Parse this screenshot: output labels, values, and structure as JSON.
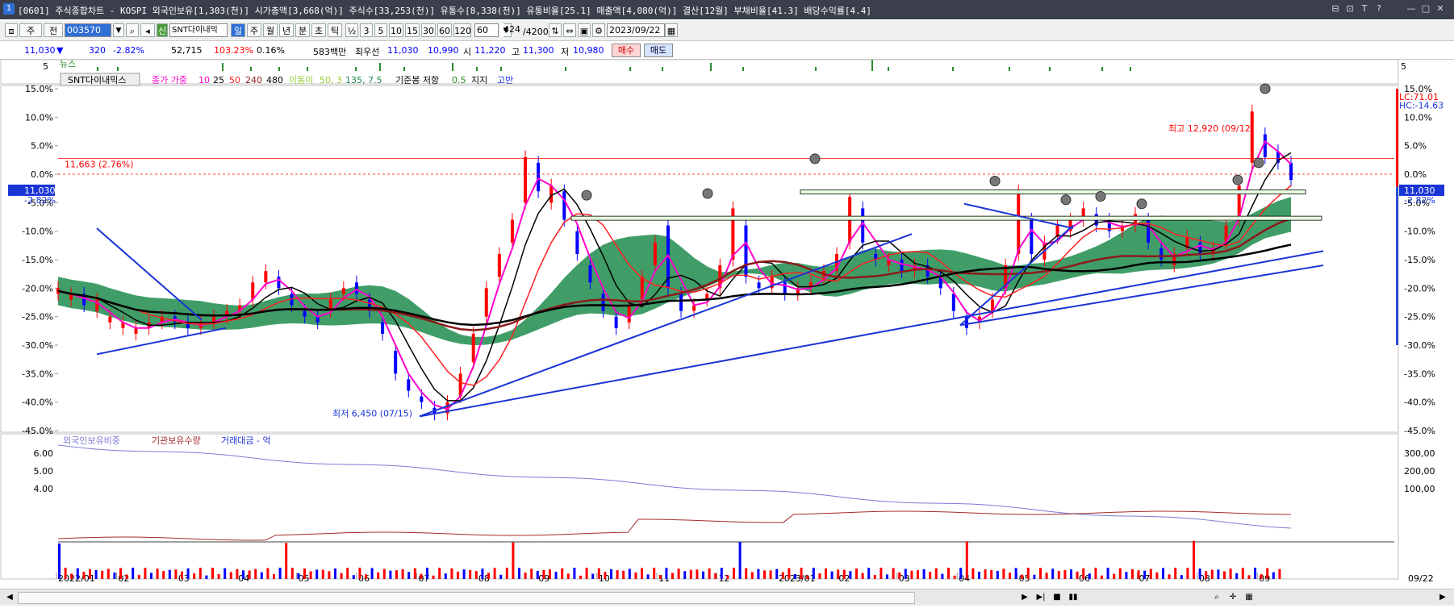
{
  "window": {
    "badge": "1",
    "title": "[0601] 주식종합차트 - KOSPI 외국인보유[1,303(천)] 시가총액[3,668(억)] 주식수[33,253(천)] 유통수[8,338(천)] 유통비율[25.1] 매출액[4,080(억)] 결산[12월] 부채비율[41.3] 배당수익률[4.4]",
    "controls": [
      "⊟",
      "⊡",
      "T",
      "?",
      "—",
      "□",
      "✕"
    ]
  },
  "toolbar": {
    "mode": "주",
    "scope": "전",
    "code": "003570",
    "search_icon": "search-icon",
    "stock_badge": "신",
    "stock_name": "SNT다이내믹",
    "periods": [
      "일",
      "주",
      "월",
      "년",
      "분",
      "초",
      "틱"
    ],
    "active_period": "일",
    "intervals": [
      "½",
      "3",
      "5",
      "10",
      "15",
      "30",
      "60",
      "120"
    ],
    "interval_value": "60",
    "count": "424",
    "count_total": "/4200",
    "date": "2023/09/22"
  },
  "quote": {
    "price": "11,030",
    "arrow": "▼",
    "change": "320",
    "change_pct": "-2.82%",
    "volume": "52,715",
    "vol_ratio": "103.23%",
    "turnover": "0.16%",
    "amount": "583백만",
    "bid_label": "최우선",
    "ask": "11,030",
    "bid": "10,990",
    "open_label": "시",
    "open": "11,220",
    "high_label": "고",
    "high": "11,300",
    "low_label": "저",
    "low": "10,980",
    "buy_label": "매수",
    "sell_label": "매도"
  },
  "colors": {
    "up": "#ff0000",
    "down": "#0000ff",
    "ma5": "#ff00cc",
    "ma10": "#000000",
    "ma25": "#ff2020",
    "ma50": "#8b1a1a",
    "ma240": "#000000",
    "cloud_lead": "#1e8c4e",
    "cloud_lag": "#9acd32",
    "trendline": "#1a35d6",
    "foreign": "#7b7bd6",
    "inst": "#a52a2a"
  },
  "chart_data": [
    {
      "type": "bar",
      "panel": "news",
      "legend": "뉴스",
      "ytick": "5",
      "x": [
        120,
        145,
        275,
        310,
        345,
        380,
        440,
        470,
        500,
        560,
        590,
        620,
        700,
        780,
        820,
        880,
        920,
        1010,
        1080,
        1100,
        1180,
        1250,
        1300,
        1365,
        1400
      ],
      "values": [
        1,
        1,
        2,
        1,
        1,
        1,
        1,
        2,
        1,
        2,
        1,
        1,
        1,
        1,
        1,
        2,
        1,
        1,
        3,
        1,
        1,
        1,
        1,
        1,
        1
      ]
    },
    {
      "type": "line",
      "panel": "price",
      "legend": {
        "name": "SNT다이내믹스",
        "ma_label": "종가 가중",
        "ma_periods": [
          "10",
          "25",
          "50",
          "240",
          "480"
        ],
        "cloud_label": "이동이",
        "cloud_params": "50, 3",
        "cloud_params2": "135, 7.5",
        "base_label": "기준봉 저항",
        "base_value": "0.5",
        "support_label": "지지",
        "high_label": "고반"
      },
      "yticks": [
        "15.0%",
        "10.0%",
        "5.0%",
        "0.0%",
        "-5.0%",
        "-10.0%",
        "-15.0%",
        "-20.0%",
        "-25.0%",
        "-30.0%",
        "-35.0%",
        "-40.0%",
        "-45.0%"
      ],
      "ytick_values": [
        15,
        10,
        5,
        0,
        -5,
        -10,
        -15,
        -20,
        -25,
        -30,
        -35,
        -40,
        -45
      ],
      "ylim": [
        -45,
        15
      ],
      "x_months": [
        "2022/01",
        "02",
        "03",
        "04",
        "05",
        "06",
        "07",
        "08",
        "09",
        "10",
        "11",
        "12",
        "2023/01",
        "02",
        "03",
        "04",
        "05",
        "06",
        "07",
        "08",
        "09",
        "09/22"
      ],
      "ref_line": {
        "label": "11,663 (2.76%)",
        "value": 2.76
      },
      "last_value": {
        "left_label": "11,030",
        "left_pct": "-2.82%",
        "right_label": "11,030",
        "right_pct": "-2.82%",
        "value": -2.82
      },
      "lc_label": "LC:71.01",
      "hc_label": "HC:-14.63",
      "high_annot": "최고 12,920 (09/12)",
      "low_annot": "최저 6,450 (07/15)",
      "resistance_bands": [
        -3.2,
        -7.8
      ],
      "price_series": [
        [
          -21,
          -20
        ],
        [
          -22,
          -21
        ],
        [
          -21,
          -23
        ],
        [
          -24,
          -22
        ],
        [
          -26,
          -25
        ],
        [
          -27,
          -26
        ],
        [
          -28,
          -27
        ],
        [
          -27,
          -26
        ],
        [
          -26,
          -25
        ],
        [
          -25,
          -26
        ],
        [
          -26,
          -27
        ],
        [
          -27,
          -26
        ],
        [
          -26,
          -25
        ],
        [
          -25,
          -24
        ],
        [
          -24,
          -23
        ],
        [
          -22,
          -19
        ],
        [
          -19,
          -17
        ],
        [
          -18,
          -20
        ],
        [
          -21,
          -23
        ],
        [
          -24,
          -25
        ],
        [
          -25,
          -26
        ],
        [
          -24,
          -22
        ],
        [
          -21,
          -20
        ],
        [
          -19,
          -21
        ],
        [
          -22,
          -24
        ],
        [
          -26,
          -28
        ],
        [
          -31,
          -35
        ],
        [
          -36,
          -38
        ],
        [
          -39,
          -40
        ],
        [
          -41,
          -42
        ],
        [
          -42,
          -40
        ],
        [
          -39,
          -35
        ],
        [
          -33,
          -28
        ],
        [
          -25,
          -20
        ],
        [
          -18,
          -14
        ],
        [
          -12,
          -8
        ],
        [
          -5,
          3
        ],
        [
          2,
          -3
        ],
        [
          -5,
          -2
        ],
        [
          -3,
          -8
        ],
        [
          -10,
          -14
        ],
        [
          -16,
          -19
        ],
        [
          -21,
          -24
        ],
        [
          -25,
          -27
        ],
        [
          -26,
          -23
        ],
        [
          -22,
          -18
        ],
        [
          -16,
          -12
        ],
        [
          -9,
          -20
        ],
        [
          -21,
          -24
        ],
        [
          -24,
          -23
        ],
        [
          -22,
          -21
        ],
        [
          -20,
          -16
        ],
        [
          -15,
          -6
        ],
        [
          -9,
          -18
        ],
        [
          -19,
          -20
        ],
        [
          -20,
          -18
        ],
        [
          -19,
          -21
        ],
        [
          -21,
          -20
        ],
        [
          -20,
          -19
        ],
        [
          -18,
          -17
        ],
        [
          -17,
          -14
        ],
        [
          -12,
          -4
        ],
        [
          -6,
          -12
        ],
        [
          -14,
          -15
        ],
        [
          -16,
          -15
        ],
        [
          -15,
          -17
        ],
        [
          -17,
          -16
        ],
        [
          -16,
          -18
        ],
        [
          -18,
          -20
        ],
        [
          -21,
          -24
        ],
        [
          -25,
          -27
        ],
        [
          -26,
          -25
        ],
        [
          -24,
          -22
        ],
        [
          -20,
          -16
        ],
        [
          -14,
          -3
        ],
        [
          -8,
          -14
        ],
        [
          -15,
          -12
        ],
        [
          -11,
          -9
        ],
        [
          -10,
          -8
        ],
        [
          -8,
          -6
        ],
        [
          -7,
          -9
        ],
        [
          -8,
          -10
        ],
        [
          -10,
          -9
        ],
        [
          -9,
          -7
        ],
        [
          -8,
          -12
        ],
        [
          -13,
          -15
        ],
        [
          -16,
          -14
        ],
        [
          -13,
          -11
        ],
        [
          -12,
          -14
        ],
        [
          -14,
          -13
        ],
        [
          -12,
          -9
        ],
        [
          -8,
          -2
        ],
        [
          2,
          11
        ],
        [
          7,
          3
        ],
        [
          4,
          2
        ],
        [
          2,
          -1
        ]
      ]
    },
    {
      "type": "bar",
      "panel": "volume",
      "legend": [
        "외국인보유비중",
        "기관보유수량",
        "거래대금 - 억"
      ],
      "yticks_left": [
        "6.00",
        "5.00",
        "4.00"
      ],
      "yticks_right": [
        "300,00",
        "200,00",
        "100,00"
      ]
    }
  ]
}
